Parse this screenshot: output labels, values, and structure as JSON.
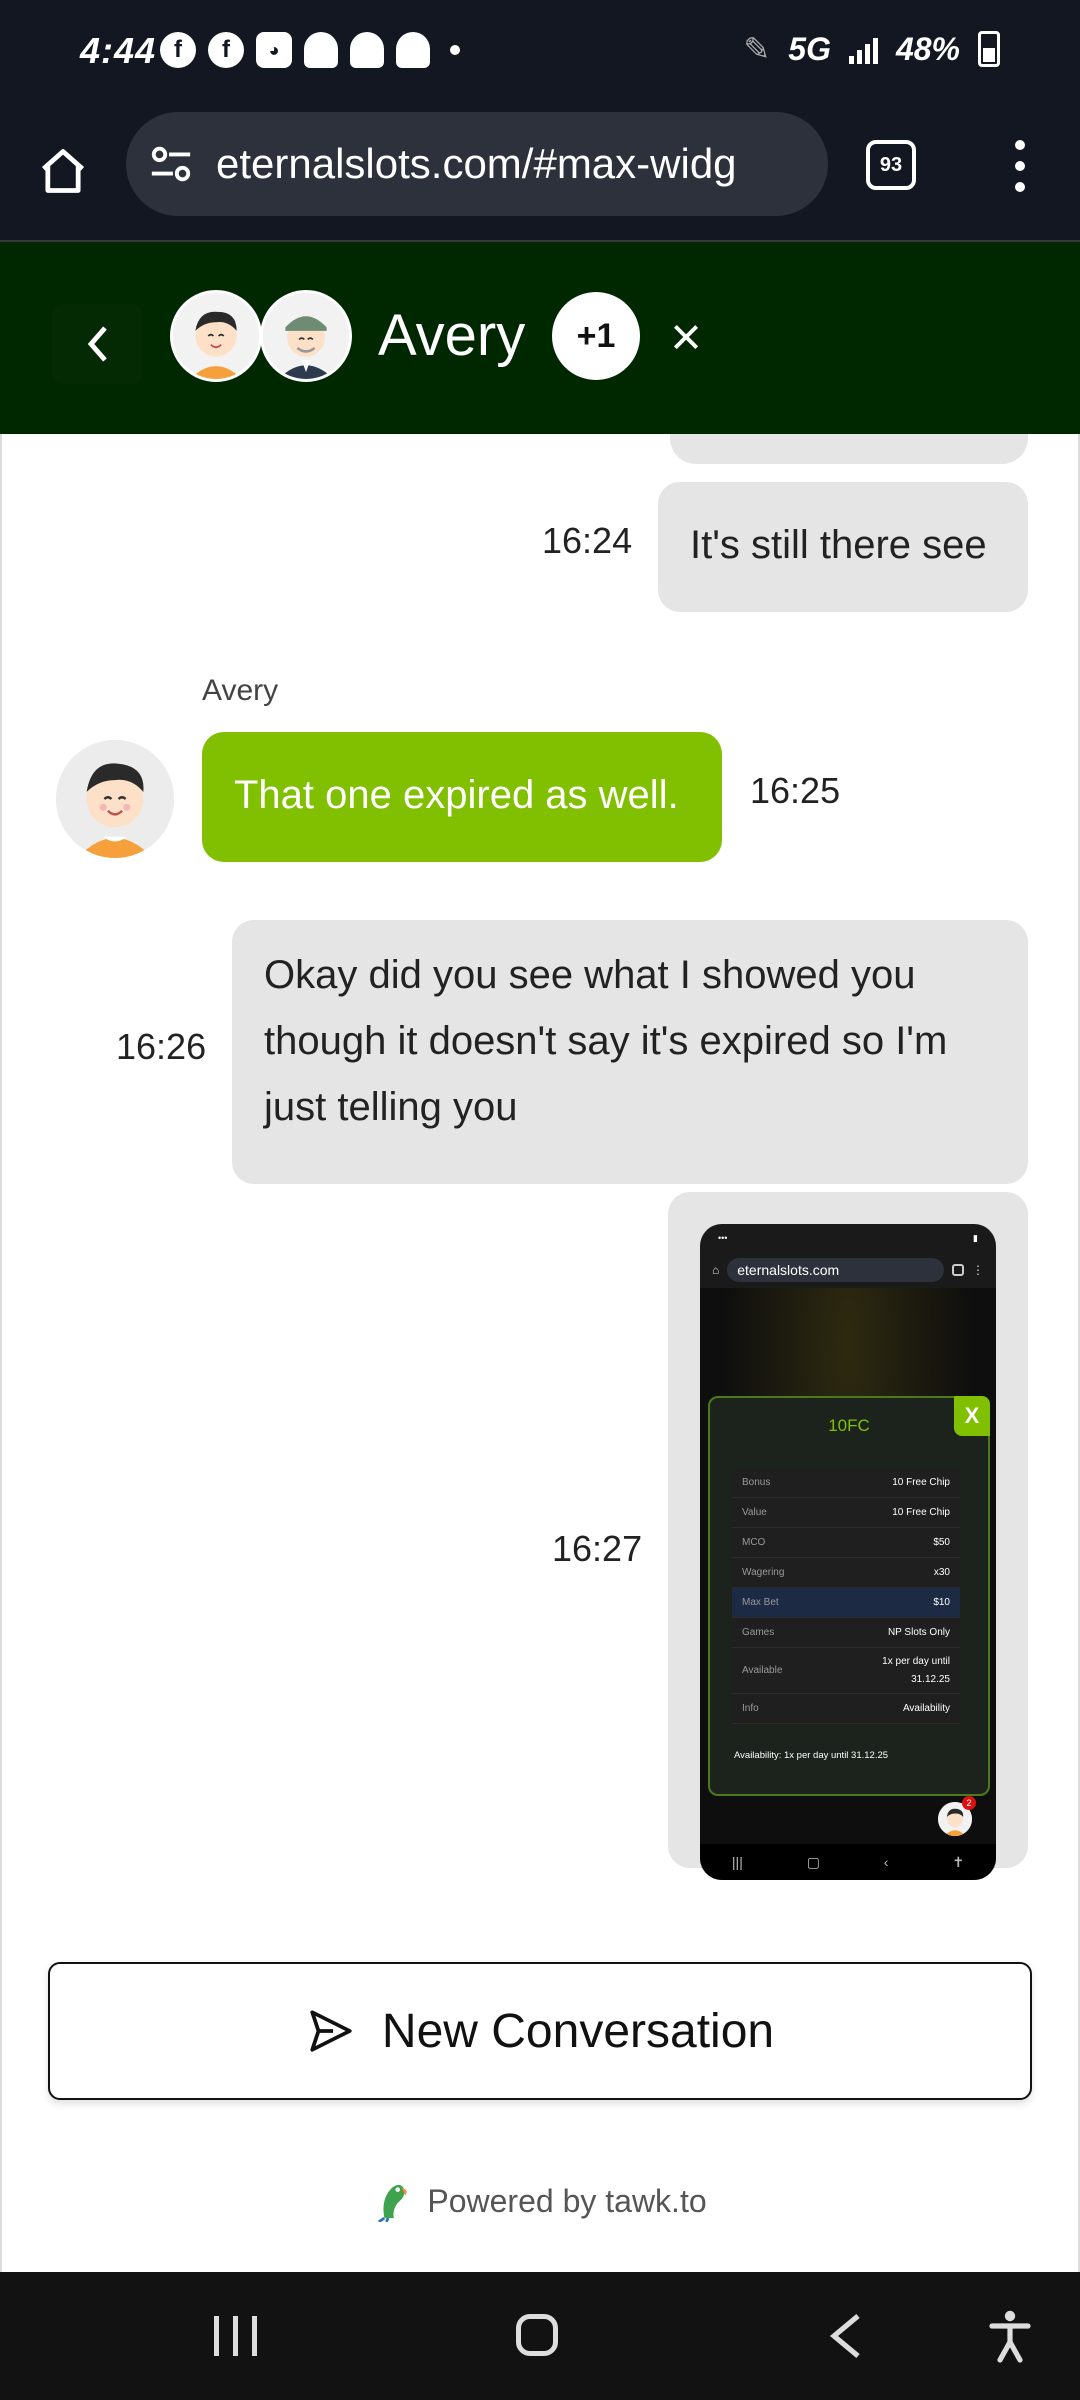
{
  "status_bar": {
    "time": "4:44",
    "network": "5G",
    "battery": "48%"
  },
  "browser": {
    "url": "eternalslots.com/#max-widg",
    "tab_count": "93"
  },
  "chat_header": {
    "agent_name": "Avery",
    "extra_participants": "+1",
    "close_symbol": "×"
  },
  "messages": [
    {
      "sender": "visitor",
      "text": "It's still there see",
      "time": "16:24"
    },
    {
      "sender": "agent",
      "sender_name": "Avery",
      "text": "That one expired as well.",
      "time": "16:25"
    },
    {
      "sender": "visitor",
      "lines": [
        "Okay did you see what I showed you",
        "though it doesn't say it's expired so I'm",
        "just telling you"
      ],
      "time": "16:26"
    },
    {
      "sender": "visitor",
      "type": "image",
      "time": "16:27"
    }
  ],
  "screenshot_attachment": {
    "url": "eternalslots.com",
    "popup_title": "10FC",
    "popup_close": "X",
    "rows": [
      {
        "key": "Bonus",
        "value": "10 Free Chip"
      },
      {
        "key": "Value",
        "value": "10 Free Chip"
      },
      {
        "key": "MCO",
        "value": "$50"
      },
      {
        "key": "Wagering",
        "value": "x30"
      },
      {
        "key": "Max Bet",
        "value": "$10"
      },
      {
        "key": "Games",
        "value": "NP Slots Only"
      },
      {
        "key": "Available",
        "value_lines": [
          "1x per day until",
          "31.12.25"
        ]
      },
      {
        "key": "Info",
        "value": "Availability"
      }
    ],
    "footer": "Availability: 1x per day until 31.12.25",
    "fab_badge": "2"
  },
  "new_conversation_label": "New Conversation",
  "powered_by": "Powered by tawk.to",
  "colors": {
    "header_bg": "#002800",
    "agent_bubble": "#80c000",
    "visitor_bubble": "#e5e5e5",
    "system_bar": "#121722"
  }
}
